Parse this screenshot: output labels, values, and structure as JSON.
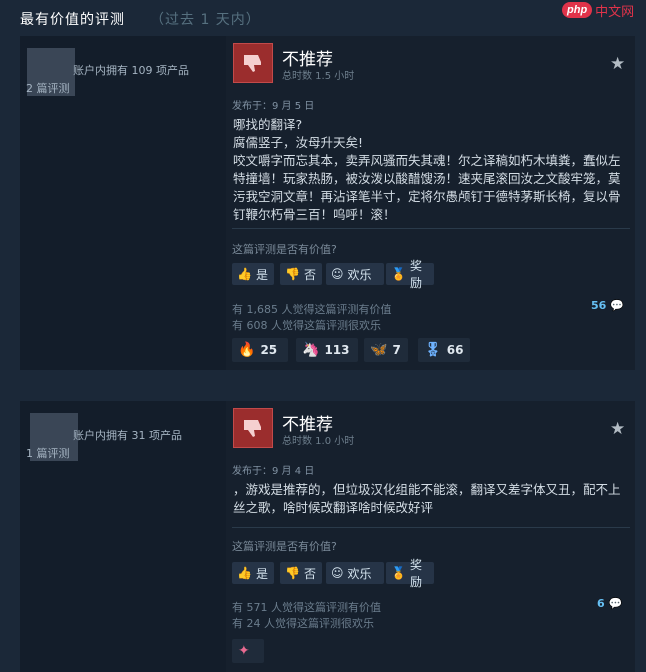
{
  "header": {
    "title": "最有价值的评测",
    "subtitle": "（过去 1 天内）"
  },
  "watermark": {
    "badge": "php",
    "text": "中文网"
  },
  "reviews": [
    {
      "owned": "账户内拥有 109 项产品",
      "review_count": "2 篇评测",
      "recommendation": "不推荐",
      "hours": "总时数 1.5 小时",
      "posted": "发布于：9 月 5 日",
      "body": [
        "哪找的翻译?",
        "腐儒竖子，汝母升天矣!",
        "咬文嚼字而忘其本，卖弄风骚而失其魂！尔之译稿如朽木填粪，蠢似左特撞墙！玩家热肠，被汝泼以酸醋馊汤！速夹尾滚回汝之文酸牢笼，莫污我空洞文章！再沾译笔半寸，定将尔愚颅钉于德特茅斯长椅，复以骨钉鞭尔朽骨三百！呜呼！滚！"
      ],
      "helpful_question": "这篇评测是否有价值?",
      "buttons": {
        "yes": "是",
        "no": "否",
        "funny": "欢乐",
        "award": "奖励"
      },
      "helpful_stat": "有 1,685 人觉得这篇评测有价值",
      "funny_stat": "有 608 人觉得这篇评测很欢乐",
      "comment_count": "56",
      "awards": [
        {
          "icon": "tumbleweed",
          "count": "25"
        },
        {
          "icon": "golden-unicorn",
          "count": "113"
        },
        {
          "icon": "wings",
          "count": "7"
        },
        {
          "icon": "medal",
          "count": "66"
        }
      ]
    },
    {
      "owned": "账户内拥有 31 项产品",
      "review_count": "1 篇评测",
      "recommendation": "不推荐",
      "hours": "总时数 1.0 小时",
      "posted": "发布于：9 月 4 日",
      "body": [
        "，游戏是推荐的，但垃圾汉化组能不能滚，翻译又差字体又丑，配不上丝之歌，啥时候改翻译啥时候改好评"
      ],
      "helpful_question": "这篇评测是否有价值?",
      "buttons": {
        "yes": "是",
        "no": "否",
        "funny": "欢乐",
        "award": "奖励"
      },
      "helpful_stat": "有 571 人觉得这篇评测有价值",
      "funny_stat": "有 24 人觉得这篇评测很欢乐",
      "comment_count": "6",
      "awards": [
        {
          "icon": "award-small"
        }
      ]
    }
  ]
}
